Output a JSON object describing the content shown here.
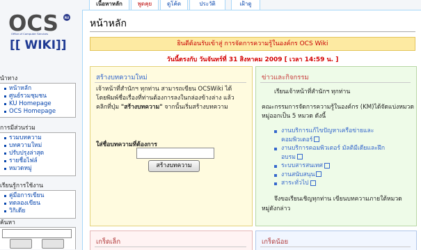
{
  "logo": {
    "brand": "OCS",
    "badge": "RU",
    "subtitle": "Office of Computer Services",
    "wiki": "[[ WIKI]]"
  },
  "sidebar": {
    "navigation": {
      "heading": "นำทาง",
      "items": [
        "หน้าหลัก",
        "ศูนย์รวมชุมชน",
        "KU Homepage",
        "OCS Homepage"
      ]
    },
    "participate": {
      "heading": "การมีส่วนร่วม",
      "items": [
        "รวมบทความ",
        "บทความใหม่",
        "ปรับปรุงล่าสุด",
        "รายชื่อไฟล์",
        "หมวดหมู่"
      ]
    },
    "help": {
      "heading": "เรียนรู้การใช้งาน",
      "items": [
        "คู่มือการเขียน",
        "ทดลองเขียน",
        "วิกิเดีย"
      ]
    },
    "search": {
      "heading": "ค้นหา"
    }
  },
  "tabs": [
    {
      "label": "เนื้อหาหลัก",
      "selected": true
    },
    {
      "label": "พูดคุย",
      "red": true
    },
    {
      "label": "ดูโค้ด"
    },
    {
      "label": "ประวัติ"
    },
    {
      "label": "เฝ้าดู"
    }
  ],
  "page": {
    "title": "หน้าหลัก",
    "welcome": "ยินดีต้อนรับเข้าสู่ การจัดการความรู้ในองค์กร OCS Wiki",
    "date": "วันนี้ตรงกับ วันจันทร์ที่ 31 สิงหาคม 2009 [ เวลา 14:59 น. ]"
  },
  "create_panel": {
    "heading": "สร้างบทความใหม่",
    "line1": "เจ้าหน้าที่สำนักฯ ทุกท่าน สามารถเขียน OCSWiki ได้",
    "line2": "โดยพิมพ์ชื่อเรื่องที่ท่านต้องการลงในกล่องข้างล่าง แล้ว",
    "line3_pre": "คลิกที่ปุ่ม ",
    "line3_bold": "\"สร้างบทความ\"",
    "line3_post": " จากนั้นเริ่มสร้างบทความ",
    "form_label": "ใส่ชื่อบทความที่ต้องการ",
    "button": "สร้างบทความ"
  },
  "news_panel": {
    "heading": "ข่าวและกิจกรรม",
    "greeting": "เรียนเจ้าหน้าที่สำนักฯ ทุกท่าน",
    "intro1": "คณะกรรมการจัดการความรู้ในองค์กร (KM)ได้จัดแบ่งหมวด",
    "intro2": "หมู่ออกเป็น 5 หมวด ดังนี้",
    "items": [
      {
        "line1": "งานบริการแก้ไขปัญหาเครือข่ายและ",
        "line2": "คอมพิวเตอร์"
      },
      {
        "line1": "งานบริการคอมพิวเตอร์ มัลติมีเดียและฝึก",
        "line2": "อบรม"
      },
      {
        "line1": "ระบบสารสนเทศ"
      },
      {
        "line1": "งานสนับสนุน"
      },
      {
        "line1": "สาระทั่วไป"
      }
    ],
    "closing1": "จึงขอเรียนเชิญทุกท่าน เขียนบทความภายใต้หมวด",
    "closing2": "หมู่ดังกล่าว"
  },
  "tips_panel": {
    "heading": "เกร็ดเล็ก"
  },
  "misc_panel": {
    "heading": "เกร็ดน้อย"
  }
}
